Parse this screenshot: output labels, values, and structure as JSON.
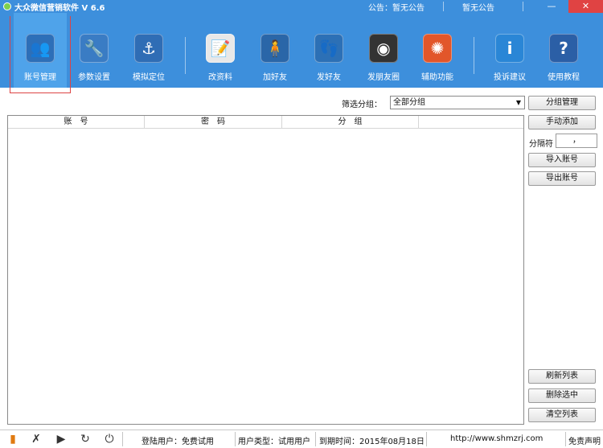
{
  "window": {
    "title": "大众微信营销软件  V 6.6",
    "notice_left": "公告：暂无公告",
    "notice_right": "暂无公告",
    "minimize": "—",
    "close": "✕"
  },
  "toolbar": {
    "items": [
      {
        "label": "账号管理",
        "icon": "users-icon",
        "glyph": "👥",
        "color": "#2d6fb8"
      },
      {
        "label": "参数设置",
        "icon": "wrench-icon",
        "glyph": "🔧",
        "color": "#3a7cc4"
      },
      {
        "label": "模拟定位",
        "icon": "anchor-icon",
        "glyph": "⚓",
        "color": "#2f6db5"
      },
      {
        "label": "改资料",
        "icon": "notebook-icon",
        "glyph": "📝",
        "color": "#e8e8e8"
      },
      {
        "label": "加好友",
        "icon": "person-icon",
        "glyph": "🧍",
        "color": "#2a66a8"
      },
      {
        "label": "发好友",
        "icon": "footprints-icon",
        "glyph": "👣",
        "color": "#2c70b6"
      },
      {
        "label": "发朋友圈",
        "icon": "camera-icon",
        "glyph": "◉",
        "color": "#333333"
      },
      {
        "label": "辅助功能",
        "icon": "ubuntu-icon",
        "glyph": "✺",
        "color": "#e2562a"
      },
      {
        "label": "投诉建议",
        "icon": "info-bubble-icon",
        "glyph": "i",
        "color": "#2a86d6"
      },
      {
        "label": "使用教程",
        "icon": "help-icon",
        "glyph": "?",
        "color": "#2b5fa6"
      }
    ]
  },
  "filter": {
    "label": "筛选分组：",
    "selected": "全部分组"
  },
  "table": {
    "columns": [
      "账　号",
      "密　码",
      "分　组"
    ]
  },
  "side_buttons": {
    "group_manage": "分组管理",
    "manual_add": "手动添加",
    "separator_label": "分隔符",
    "separator_value": "，",
    "import": "导入账号",
    "export": "导出账号",
    "refresh": "刷新列表",
    "delete_selected": "删除选中",
    "clear_list": "清空列表"
  },
  "status": {
    "login_user": "登陆用户：免费试用",
    "user_type": "用户类型：试用用户",
    "expire": "到期时间：2015年08月18日",
    "url": "http://www.shmzrj.com",
    "disclaimer": "免责声明"
  }
}
